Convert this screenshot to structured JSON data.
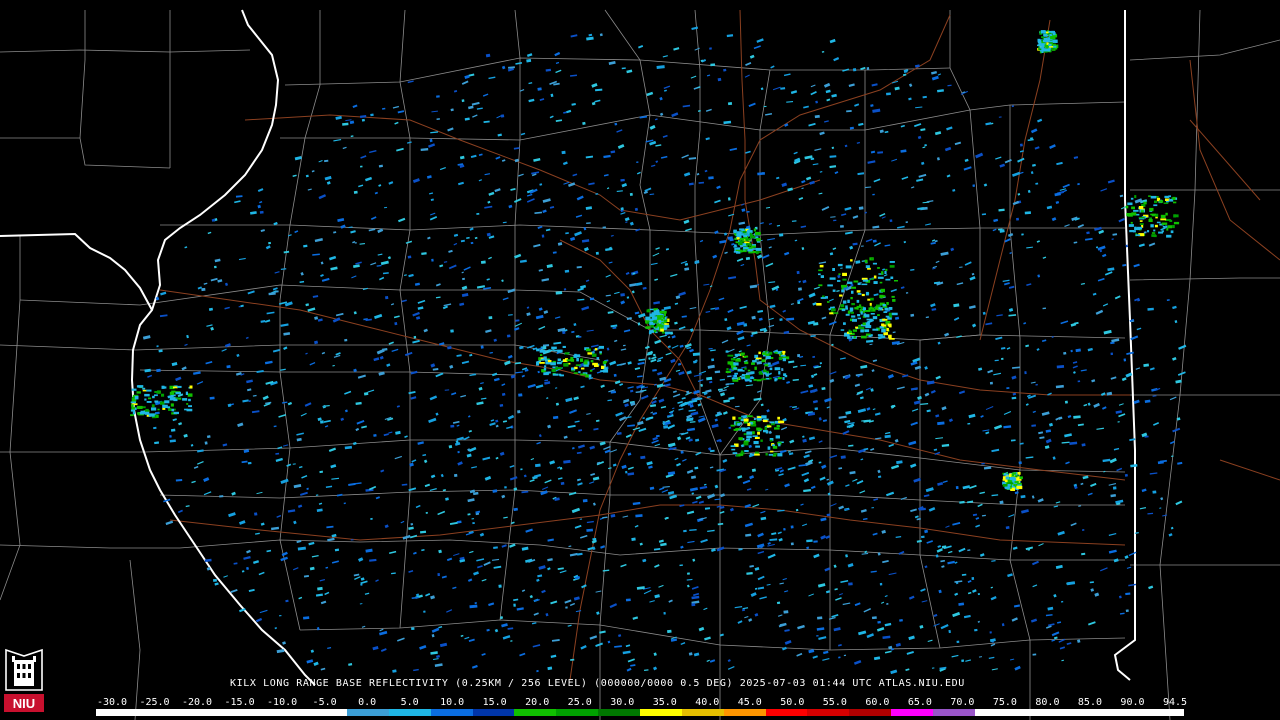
{
  "product_caption": "KILX LONG RANGE BASE REFLECTIVITY (0.25KM / 256 LEVEL) (000000/0000 0.5 DEG) 2025-07-03 01:44 UTC  ATLAS.NIU.EDU",
  "logo_text": "NIU",
  "scale_labels": [
    "-30.0",
    "-25.0",
    "-20.0",
    "-15.0",
    "-10.0",
    "-5.0",
    "0.0",
    "5.0",
    "10.0",
    "15.0",
    "20.0",
    "25.0",
    "30.0",
    "35.0",
    "40.0",
    "45.0",
    "50.0",
    "55.0",
    "60.0",
    "65.0",
    "70.0",
    "75.0",
    "80.0",
    "85.0",
    "90.0",
    "94.5"
  ],
  "scale_colors": [
    "#000000",
    "#000000",
    "#000000",
    "#000000",
    "#000000",
    "#000000",
    "#3c9fd6",
    "#1fb7e6",
    "#0a6de0",
    "#0035a8",
    "#10c000",
    "#00a000",
    "#007800",
    "#ffff00",
    "#e6c000",
    "#ff9600",
    "#ff0000",
    "#d60000",
    "#b00000",
    "#ff00ff",
    "#9955c8",
    "#ffffff",
    "#ffffff",
    "#ffffff",
    "#ffffff",
    "#ffffff"
  ],
  "colors": {
    "background": "#000000",
    "county_lines": "#8c8c8c",
    "state_lines": "#ffffff",
    "highways": "#8b4020",
    "logo_red": "#c8102e"
  }
}
